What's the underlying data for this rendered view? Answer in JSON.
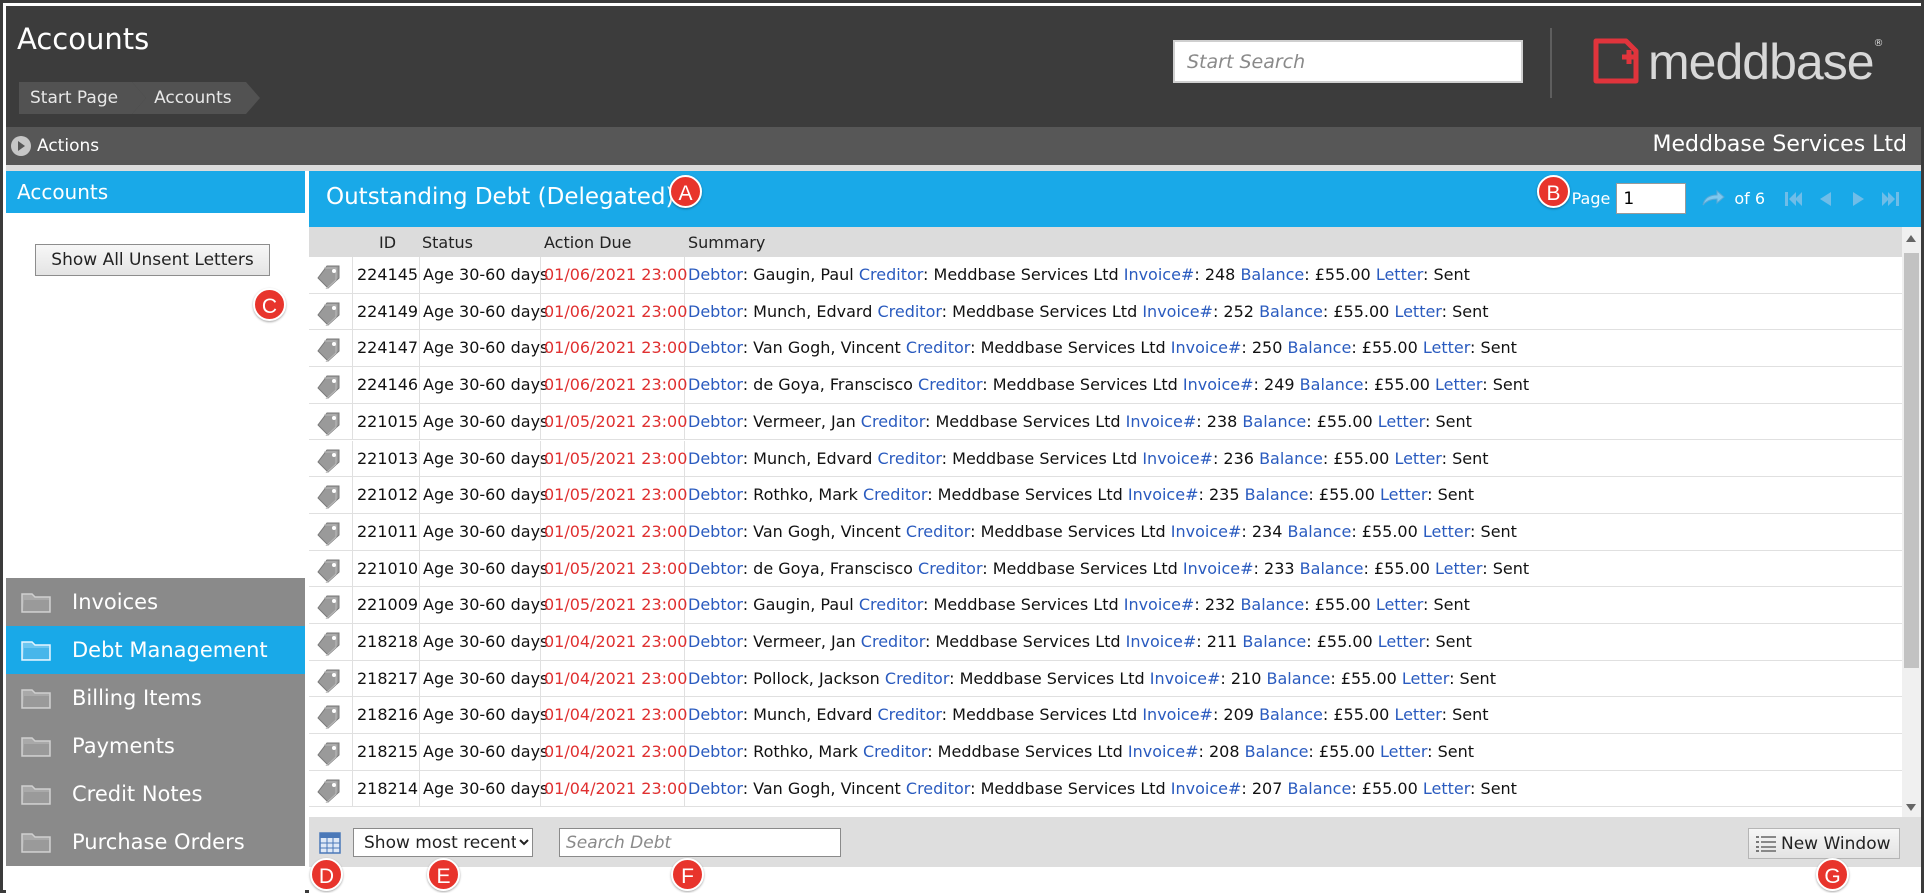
{
  "header": {
    "title": "Accounts",
    "breadcrumb": [
      "Start Page",
      "Accounts"
    ],
    "search_placeholder": "Start Search",
    "logo_text": "meddbase",
    "logo_reg": "®"
  },
  "actions_bar": {
    "actions_label": "Actions",
    "company": "Meddbase Services Ltd"
  },
  "sidebar": {
    "title": "Accounts",
    "unsent_button": "Show All Unsent Letters",
    "nav": [
      {
        "label": "Invoices",
        "active": false
      },
      {
        "label": "Debt Management",
        "active": true
      },
      {
        "label": "Billing Items",
        "active": false
      },
      {
        "label": "Payments",
        "active": false
      },
      {
        "label": "Credit Notes",
        "active": false
      },
      {
        "label": "Purchase Orders",
        "active": false
      }
    ]
  },
  "panel": {
    "title": "Outstanding Debt (Delegated)",
    "pager": {
      "page_label": "Page",
      "page_value": "1",
      "of_label": "of 6"
    }
  },
  "grid": {
    "columns": [
      "ID",
      "Status",
      "Action Due",
      "Summary"
    ],
    "summary_keys": {
      "debtor": "Debtor",
      "creditor": "Creditor",
      "invoice": "Invoice#",
      "balance": "Balance",
      "letter": "Letter"
    },
    "rows": [
      {
        "id": "224145",
        "status": "Age 30-60 days",
        "due": "01/06/2021 23:00",
        "debtor": "Gaugin, Paul",
        "creditor": "Meddbase Services Ltd",
        "invoice": "248",
        "balance": "£55.00",
        "letter": "Sent"
      },
      {
        "id": "224149",
        "status": "Age 30-60 days",
        "due": "01/06/2021 23:00",
        "debtor": "Munch, Edvard",
        "creditor": "Meddbase Services Ltd",
        "invoice": "252",
        "balance": "£55.00",
        "letter": "Sent"
      },
      {
        "id": "224147",
        "status": "Age 30-60 days",
        "due": "01/06/2021 23:00",
        "debtor": "Van Gogh, Vincent",
        "creditor": "Meddbase Services Ltd",
        "invoice": "250",
        "balance": "£55.00",
        "letter": "Sent"
      },
      {
        "id": "224146",
        "status": "Age 30-60 days",
        "due": "01/06/2021 23:00",
        "debtor": "de Goya, Franscisco",
        "creditor": "Meddbase Services Ltd",
        "invoice": "249",
        "balance": "£55.00",
        "letter": "Sent"
      },
      {
        "id": "221015",
        "status": "Age 30-60 days",
        "due": "01/05/2021 23:00",
        "debtor": "Vermeer, Jan",
        "creditor": "Meddbase Services Ltd",
        "invoice": "238",
        "balance": "£55.00",
        "letter": "Sent"
      },
      {
        "id": "221013",
        "status": "Age 30-60 days",
        "due": "01/05/2021 23:00",
        "debtor": "Munch, Edvard",
        "creditor": "Meddbase Services Ltd",
        "invoice": "236",
        "balance": "£55.00",
        "letter": "Sent"
      },
      {
        "id": "221012",
        "status": "Age 30-60 days",
        "due": "01/05/2021 23:00",
        "debtor": "Rothko, Mark",
        "creditor": "Meddbase Services Ltd",
        "invoice": "235",
        "balance": "£55.00",
        "letter": "Sent"
      },
      {
        "id": "221011",
        "status": "Age 30-60 days",
        "due": "01/05/2021 23:00",
        "debtor": "Van Gogh, Vincent",
        "creditor": "Meddbase Services Ltd",
        "invoice": "234",
        "balance": "£55.00",
        "letter": "Sent"
      },
      {
        "id": "221010",
        "status": "Age 30-60 days",
        "due": "01/05/2021 23:00",
        "debtor": "de Goya, Franscisco",
        "creditor": "Meddbase Services Ltd",
        "invoice": "233",
        "balance": "£55.00",
        "letter": "Sent"
      },
      {
        "id": "221009",
        "status": "Age 30-60 days",
        "due": "01/05/2021 23:00",
        "debtor": "Gaugin, Paul",
        "creditor": "Meddbase Services Ltd",
        "invoice": "232",
        "balance": "£55.00",
        "letter": "Sent"
      },
      {
        "id": "218218",
        "status": "Age 30-60 days",
        "due": "01/04/2021 23:00",
        "debtor": "Vermeer, Jan",
        "creditor": "Meddbase Services Ltd",
        "invoice": "211",
        "balance": "£55.00",
        "letter": "Sent"
      },
      {
        "id": "218217",
        "status": "Age 30-60 days",
        "due": "01/04/2021 23:00",
        "debtor": "Pollock, Jackson",
        "creditor": "Meddbase Services Ltd",
        "invoice": "210",
        "balance": "£55.00",
        "letter": "Sent"
      },
      {
        "id": "218216",
        "status": "Age 30-60 days",
        "due": "01/04/2021 23:00",
        "debtor": "Munch, Edvard",
        "creditor": "Meddbase Services Ltd",
        "invoice": "209",
        "balance": "£55.00",
        "letter": "Sent"
      },
      {
        "id": "218215",
        "status": "Age 30-60 days",
        "due": "01/04/2021 23:00",
        "debtor": "Rothko, Mark",
        "creditor": "Meddbase Services Ltd",
        "invoice": "208",
        "balance": "£55.00",
        "letter": "Sent"
      },
      {
        "id": "218214",
        "status": "Age 30-60 days",
        "due": "01/04/2021 23:00",
        "debtor": "Van Gogh, Vincent",
        "creditor": "Meddbase Services Ltd",
        "invoice": "207",
        "balance": "£55.00",
        "letter": "Sent"
      }
    ]
  },
  "footer": {
    "recent_select": "Show most recent",
    "search_placeholder": "Search Debt",
    "new_window": "New Window"
  },
  "markers": [
    "A",
    "B",
    "C",
    "D",
    "E",
    "F",
    "G"
  ],
  "colors": {
    "accent": "#19a9e8",
    "header_bg": "#3c3c3c",
    "actions_bg": "#575757",
    "due_red": "#e03030",
    "key_blue": "#2a5bbf",
    "marker_red": "#e8342c",
    "logo_red": "#e0343c"
  }
}
